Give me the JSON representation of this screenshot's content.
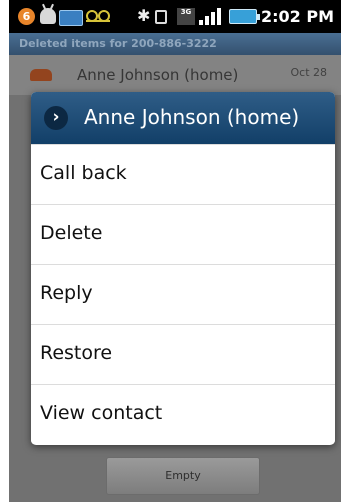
{
  "status_bar": {
    "notification_count": "6",
    "time": "2:02 PM",
    "network_type": "3G",
    "icons": [
      "notification-badge",
      "android-icon",
      "storage-icon",
      "voicemail-icon",
      "bluetooth-icon",
      "vibrate-icon",
      "3g-icon",
      "signal-icon",
      "battery-icon"
    ]
  },
  "title_bar": {
    "title": "Deleted items for 200-886-3222"
  },
  "background_list": {
    "rows": [
      {
        "name": "Anne  Johnson (home)",
        "date": "Oct 28"
      }
    ]
  },
  "dialog": {
    "title": "Anne  Johnson (home)",
    "items": [
      {
        "label": "Call back"
      },
      {
        "label": "Delete"
      },
      {
        "label": "Reply"
      },
      {
        "label": "Restore"
      },
      {
        "label": "View contact"
      }
    ]
  },
  "bottom": {
    "empty_label": "Empty"
  },
  "colors": {
    "header_gradient_top": "#2f5d87",
    "header_gradient_bottom": "#123f68",
    "dim_background": "#8e8e8e",
    "battery": "#37a0d8"
  }
}
